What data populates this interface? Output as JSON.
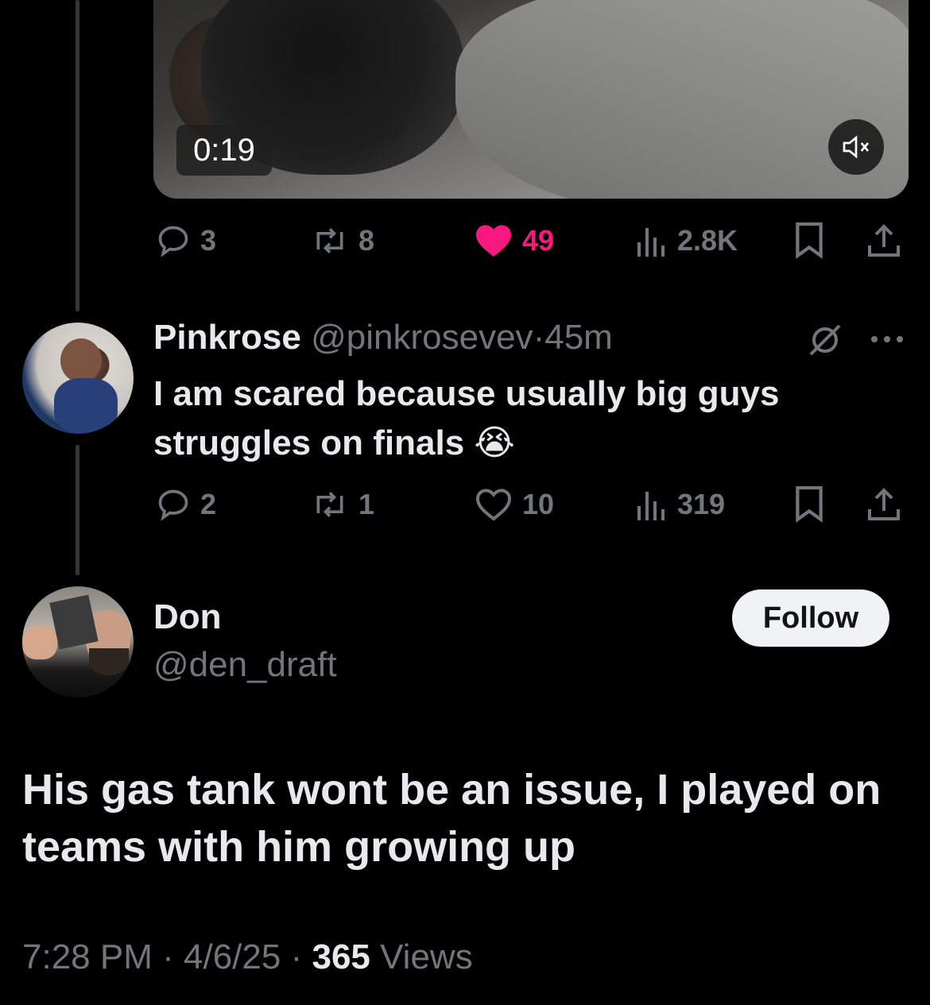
{
  "video": {
    "duration": "0:19",
    "mute_icon": "volume-muted-icon"
  },
  "main_actions": {
    "replies": "3",
    "reposts": "8",
    "likes": "49",
    "views": "2.8K",
    "like_color": "#f91880"
  },
  "reply": {
    "display_name": "Pinkrose",
    "handle": "@pinkrosevev",
    "separator": "·",
    "time": "45m",
    "text_line1": "I am scared because usually big guys",
    "text_line2": "struggles on finals",
    "emoji": "😭",
    "replies": "2",
    "reposts": "1",
    "likes": "10",
    "views": "319"
  },
  "tweet": {
    "display_name": "Don",
    "handle": "@den_draft",
    "follow_label": "Follow",
    "text": "His gas tank wont be an issue, I played on teams with him growing up",
    "time": "7:28 PM",
    "sep1": "·",
    "date": "4/6/25",
    "sep2": "·",
    "views_count": "365",
    "views_label": "Views"
  },
  "colors": {
    "background": "#000000",
    "text": "#e7e9ea",
    "muted": "#71767b",
    "like": "#f91880"
  }
}
